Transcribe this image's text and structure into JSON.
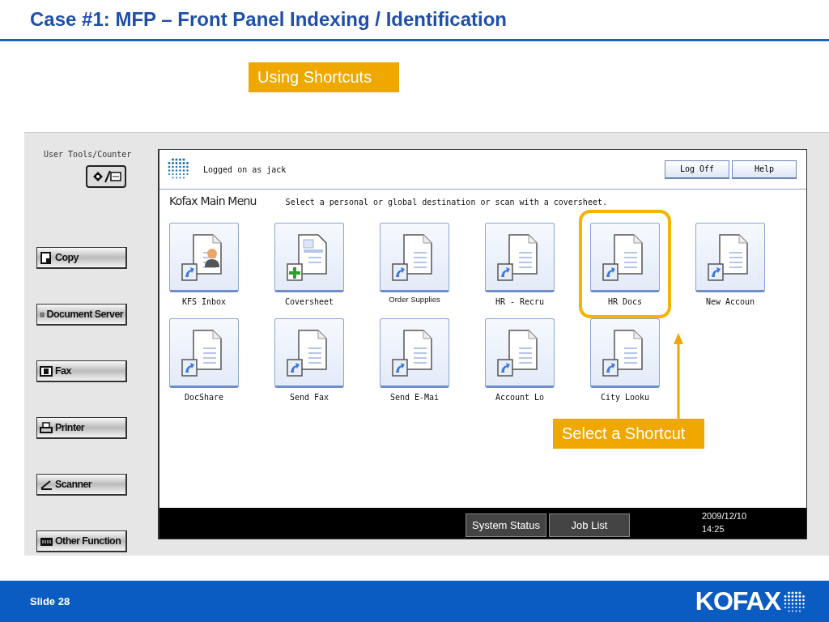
{
  "slide_title": "Case #1: MFP – Front Panel Indexing / Identification",
  "callouts": [
    {
      "text": "Using Shortcuts"
    },
    {
      "text": "Select a Shortcut"
    }
  ],
  "panel": {
    "user_tools_label": "User Tools/Counter",
    "modes": [
      {
        "label": "Copy",
        "kind": "copy"
      },
      {
        "label": "Document Server",
        "kind": "server"
      },
      {
        "label": "Fax",
        "kind": "fax"
      },
      {
        "label": "Printer",
        "kind": "printer"
      },
      {
        "label": "Scanner",
        "kind": "scanner"
      },
      {
        "label": "Other Function",
        "kind": "other"
      }
    ]
  },
  "screen": {
    "user": "Logged on as jack",
    "buttons": [
      "Log Off",
      "Help"
    ],
    "menu_title": "Kofax Main Menu",
    "instruction": "Select a personal or global destination or scan with a coversheet.",
    "shortcuts": [
      {
        "label": "KFS Inbox",
        "kind": "person",
        "highlighted": false
      },
      {
        "label": "Coversheet",
        "kind": "coversheet",
        "highlighted": false
      },
      {
        "label": "Order Supplies",
        "kind": "shortcut",
        "highlighted": false
      },
      {
        "label": "HR - Recru",
        "kind": "shortcut",
        "highlighted": false
      },
      {
        "label": "HR Docs",
        "kind": "shortcut",
        "highlighted": true
      },
      {
        "label": "New Accoun",
        "kind": "shortcut",
        "highlighted": false
      },
      {
        "label": "DocShare",
        "kind": "shortcut",
        "highlighted": false
      },
      {
        "label": "Send Fax",
        "kind": "shortcut",
        "highlighted": false
      },
      {
        "label": "Send E-Mai",
        "kind": "shortcut",
        "highlighted": false
      },
      {
        "label": "Account Lo",
        "kind": "shortcut",
        "highlighted": false
      },
      {
        "label": "City Looku",
        "kind": "shortcut",
        "highlighted": false
      }
    ],
    "status_buttons": [
      "System Status",
      "Job List"
    ],
    "date": "2009/12/10",
    "time": "14:25"
  },
  "footer": {
    "slide_number": "Slide 28",
    "logo": "KOFAX"
  }
}
